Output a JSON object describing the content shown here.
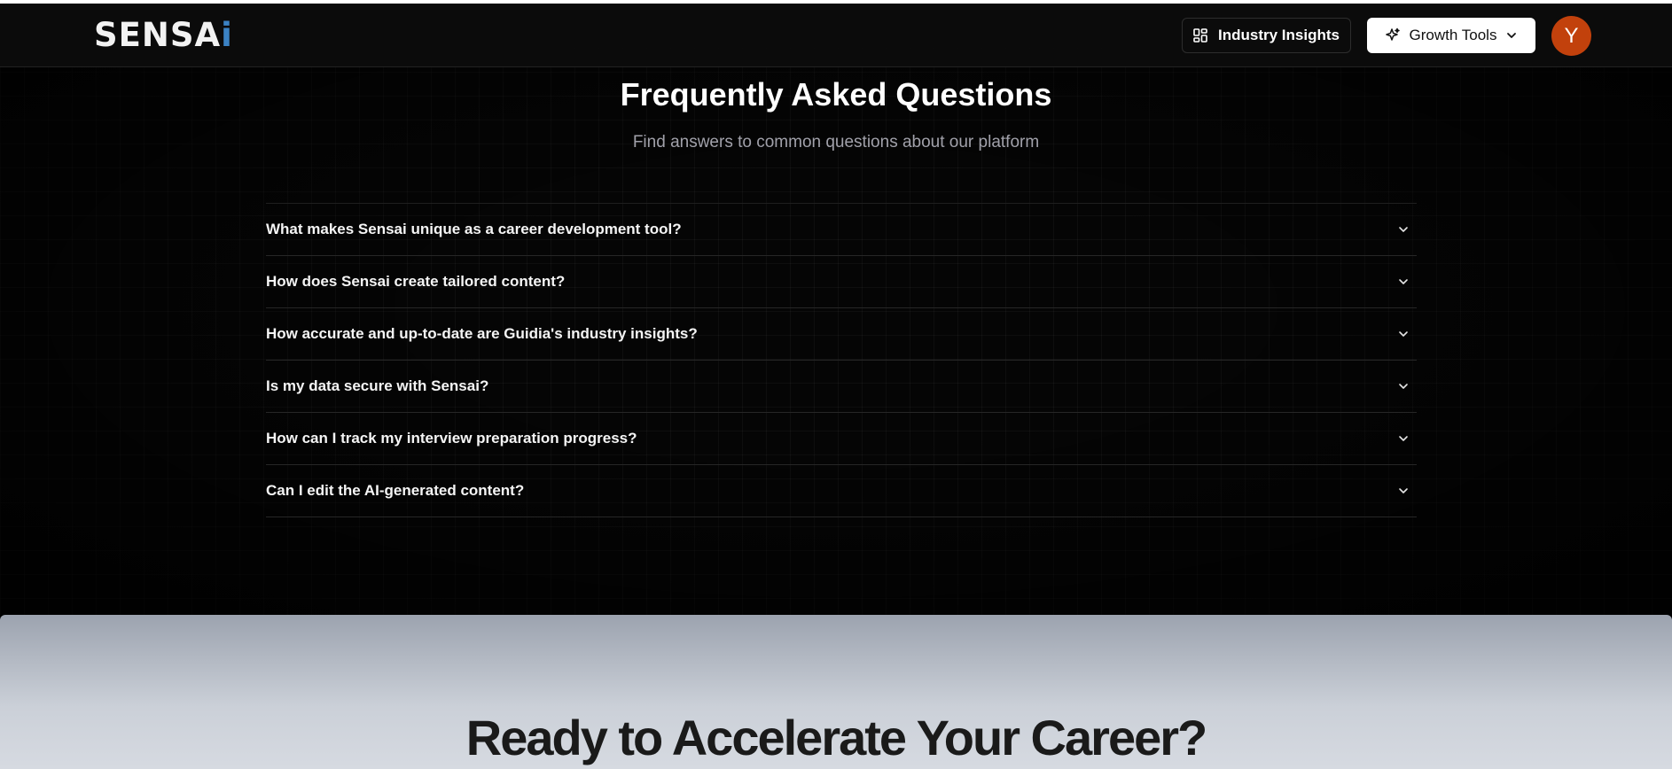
{
  "header": {
    "logo_main": "SENSA",
    "logo_accent": "i",
    "insights_label": "Industry Insights",
    "growth_label": "Growth Tools",
    "avatar_initial": "Y"
  },
  "faq": {
    "title": "Frequently Asked Questions",
    "subtitle": "Find answers to common questions about our platform",
    "items": [
      {
        "question": "What makes Sensai unique as a career development tool?"
      },
      {
        "question": "How does Sensai create tailored content?"
      },
      {
        "question": "How accurate and up-to-date are Guidia's industry insights?"
      },
      {
        "question": "Is my data secure with Sensai?"
      },
      {
        "question": "How can I track my interview preparation progress?"
      },
      {
        "question": "Can I edit the AI-generated content?"
      }
    ]
  },
  "cta": {
    "title": "Ready to Accelerate Your Career?"
  },
  "colors": {
    "accent": "#3b82c4",
    "avatar": "#c2410c",
    "background": "#000000"
  },
  "icons": {
    "insights": "layout-dashboard-icon",
    "growth": "sparkles-icon",
    "dropdown": "chevron-down-icon"
  }
}
